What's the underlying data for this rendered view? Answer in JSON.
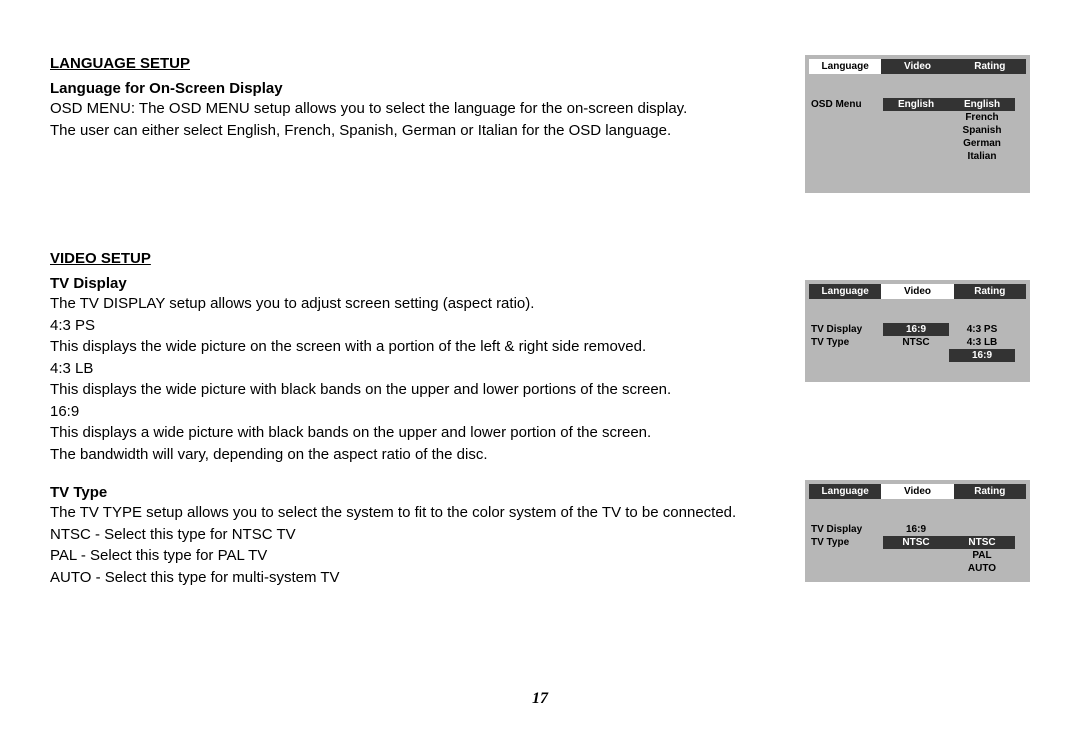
{
  "page_number": "17",
  "s1": {
    "title": "LANGUAGE SETUP",
    "sub": "Language for On-Screen Display",
    "p1": "OSD MENU: The OSD MENU setup allows you to select the language for the on-screen display.",
    "p2": "The user can either select English, French, Spanish, German or Italian for the OSD language."
  },
  "s2": {
    "title": "VIDEO SETUP",
    "sub": "TV Display",
    "p1": "The TV DISPLAY setup allows you to adjust screen setting (aspect ratio).",
    "o1": "4:3 PS",
    "p2": "This displays the wide picture on the screen with a portion of the left & right side removed.",
    "o2": "4:3 LB",
    "p3": "This displays the wide picture with black bands on the upper and lower portions of the screen.",
    "o3": "16:9",
    "p4": "This displays a wide picture with black bands on the upper and lower portion of the screen.",
    "p5": "The bandwidth will vary, depending on the aspect ratio of the disc."
  },
  "s3": {
    "sub": "TV Type",
    "p1": "The TV TYPE setup allows you to select the system to fit to the color system of the TV to be connected.",
    "p2": "NTSC - Select this type for NTSC TV",
    "p3": "PAL - Select this type for PAL TV",
    "p4": "AUTO - Select this type for multi-system TV"
  },
  "osd1": {
    "tabs": [
      "Language",
      "Video",
      "Rating"
    ],
    "label1": "OSD Menu",
    "val1": "English",
    "opts": [
      "English",
      "French",
      "Spanish",
      "German",
      "Italian"
    ]
  },
  "osd2": {
    "tabs": [
      "Language",
      "Video",
      "Rating"
    ],
    "label1": "TV Display",
    "val1": "16:9",
    "label2": "TV Type",
    "val2": "NTSC",
    "opts": [
      "4:3 PS",
      "4:3 LB",
      "16:9"
    ]
  },
  "osd3": {
    "tabs": [
      "Language",
      "Video",
      "Rating"
    ],
    "label1": "TV Display",
    "val1": "16:9",
    "label2": "TV Type",
    "val2": "NTSC",
    "opts": [
      "NTSC",
      "PAL",
      "AUTO"
    ]
  }
}
